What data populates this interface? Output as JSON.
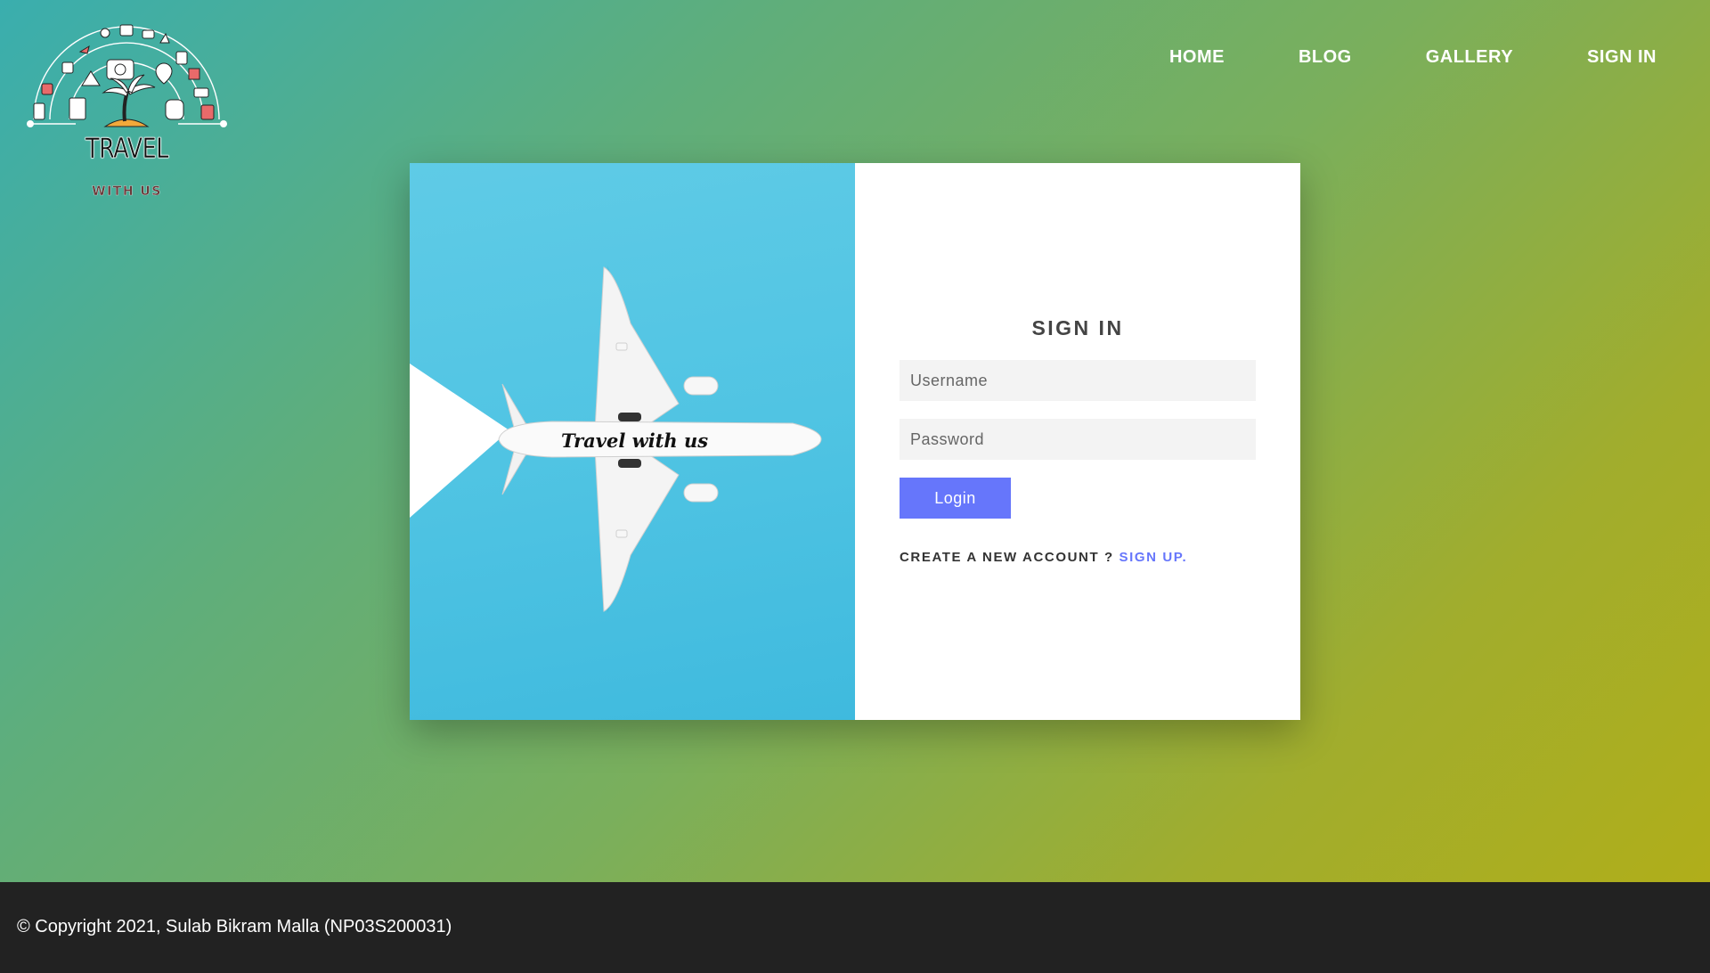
{
  "logo": {
    "title": "TRAVEL",
    "subtitle": "WITH US"
  },
  "nav": {
    "items": [
      {
        "label": "HOME"
      },
      {
        "label": "BLOG"
      },
      {
        "label": "GALLERY"
      },
      {
        "label": "SIGN IN"
      }
    ]
  },
  "hero_image": {
    "plane_text": "Travel with us"
  },
  "form": {
    "title": "SIGN IN",
    "username_placeholder": "Username",
    "password_placeholder": "Password",
    "login_label": "Login",
    "signup_prompt": "CREATE A NEW ACCOUNT ?",
    "signup_link": "SIGN UP."
  },
  "footer": {
    "copyright": "© Copyright 2021, Sulab Bikram Malla (NP03S200031)"
  },
  "colors": {
    "accent": "#6676fb",
    "footer_bg": "#222222",
    "gradient_start": "#3aaeae",
    "gradient_end": "#b0ae1a",
    "image_bg": "#50c4e3"
  }
}
